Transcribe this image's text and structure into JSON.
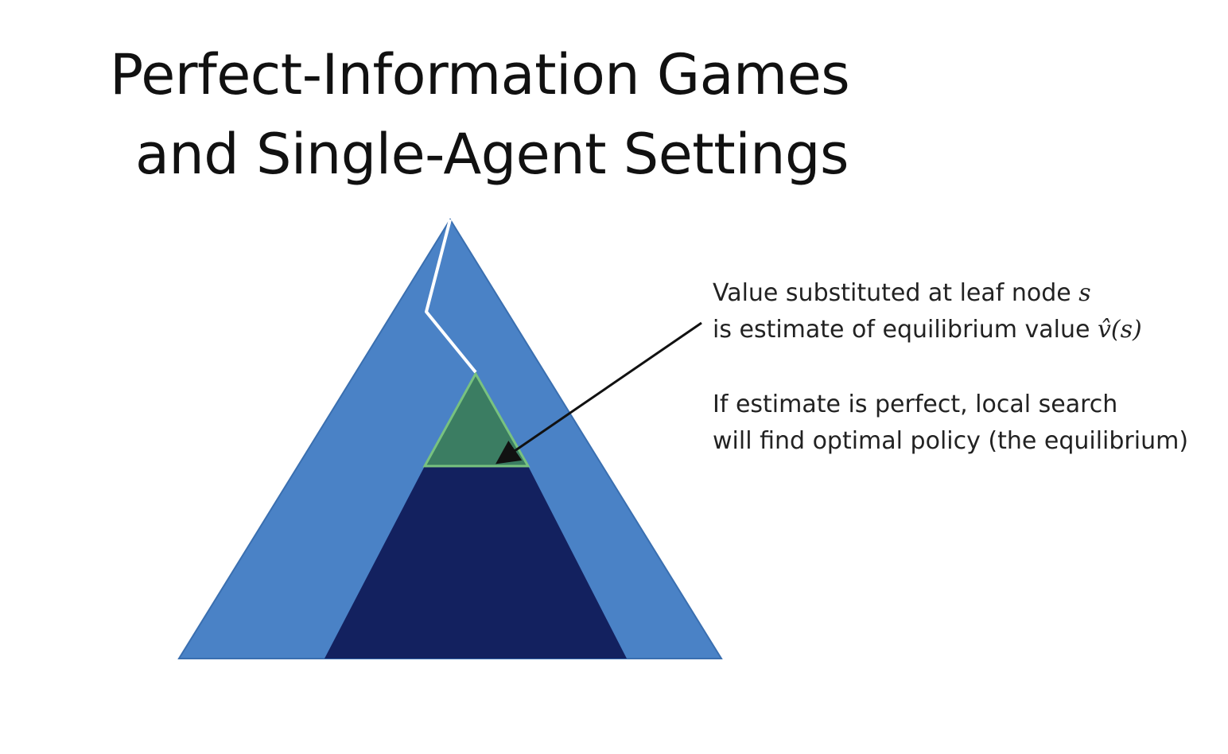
{
  "slide": {
    "title_line1": "Perfect-Information Games",
    "title_line2": "and Single-Agent Settings"
  },
  "annotation_value": {
    "line1_text": "Value substituted at leaf node ",
    "line1_math": "s",
    "line2_text": "is estimate of equilibrium value ",
    "line2_math": "v̂(s)"
  },
  "annotation_search": {
    "line1": "If estimate is perfect, local search",
    "line2": "will find optimal policy (the equilibrium)"
  },
  "colors": {
    "game_tree": "#4a82c6",
    "subgame_region": "#13215f",
    "leaf_subtree": "#3b7d62",
    "leaf_subtree_border": "#78c27f",
    "path": "#ffffff",
    "arrow": "#111111"
  }
}
